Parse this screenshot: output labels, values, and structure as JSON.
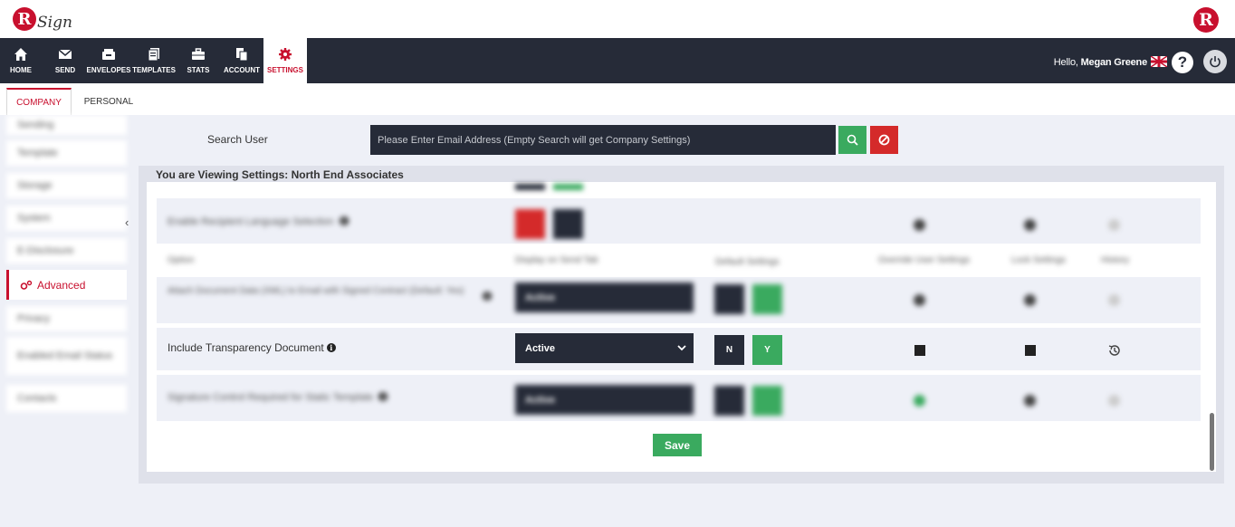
{
  "brand": {
    "logo_letter": "R",
    "logo_text": "Sign"
  },
  "nav": {
    "items": [
      {
        "label": "HOME",
        "icon": "home-icon"
      },
      {
        "label": "SEND",
        "icon": "envelope-icon"
      },
      {
        "label": "ENVELOPES",
        "icon": "inbox-icon"
      },
      {
        "label": "TEMPLATES",
        "icon": "templates-icon"
      },
      {
        "label": "STATS",
        "icon": "briefcase-icon"
      },
      {
        "label": "ACCOUNT",
        "icon": "account-icon"
      },
      {
        "label": "SETTINGS",
        "icon": "gear-icon"
      }
    ],
    "greeting": "Hello,",
    "user_name": "Megan Greene"
  },
  "tabs": [
    {
      "label": "COMPANY"
    },
    {
      "label": "PERSONAL"
    }
  ],
  "sidebar": {
    "items": [
      {
        "label": "Sending"
      },
      {
        "label": "Template"
      },
      {
        "label": "Storage"
      },
      {
        "label": "System"
      },
      {
        "label": "E-Disclosure"
      },
      {
        "label": "Advanced"
      },
      {
        "label": "Privacy"
      },
      {
        "label": "Enabled Email Status"
      },
      {
        "label": "Contacts"
      }
    ]
  },
  "search": {
    "label": "Search User",
    "placeholder": "Please Enter Email Address (Empty Search will get Company Settings)"
  },
  "panel": {
    "title": "You are Viewing Settings: North End Associates",
    "columns": [
      "Option",
      "Display on Send Tab",
      "Default Settings",
      "Override User Settings",
      "Lock Settings",
      "History"
    ],
    "blurred_rows": [
      "Enable Recipient Language Selection",
      "Attach Document Data (XML) to Email with Signed Contract (Default: Yes)",
      "Signature Control Required for Static Template"
    ],
    "focus_row": {
      "label": "Include Transparency Document",
      "select_value": "Active",
      "n_label": "N",
      "y_label": "Y"
    },
    "blurred_select_value": "Active",
    "save_label": "Save"
  },
  "colors": {
    "accent": "#c8102e",
    "nav_bg": "#262b38",
    "green": "#3aaa5f",
    "red": "#d42a2a"
  }
}
